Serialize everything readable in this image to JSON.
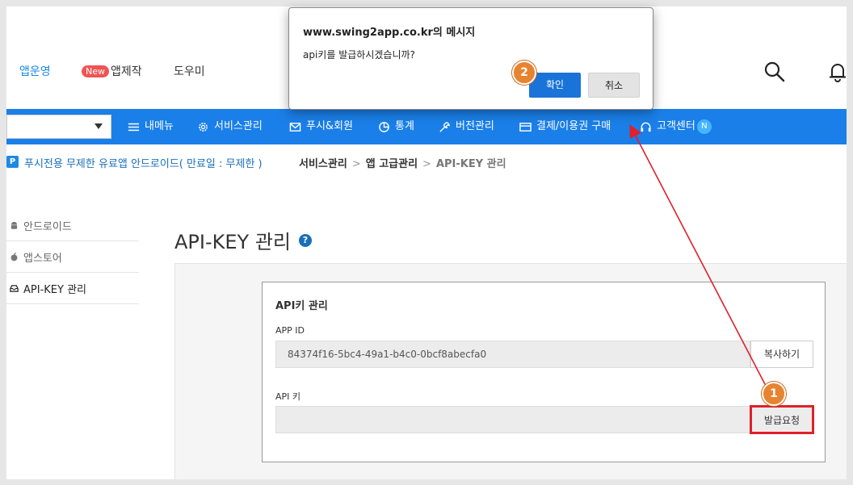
{
  "colors": {
    "accent": "#1a7fe8",
    "annotation_red": "#e0202a",
    "step_orange": "#e8832f",
    "new_badge": "#ef5454"
  },
  "topnav": {
    "items": [
      {
        "label": "앱운영"
      },
      {
        "badge": "New",
        "label": "앱제작"
      },
      {
        "label": "도우미"
      }
    ],
    "icons": [
      "search-icon",
      "bell-icon"
    ]
  },
  "menubar": {
    "items": [
      {
        "label": "내메뉴",
        "icon": "hamburger-icon"
      },
      {
        "label": "서비스관리",
        "icon": "gear-icon"
      },
      {
        "label": "푸시&회원",
        "icon": "mail-icon"
      },
      {
        "label": "통계",
        "icon": "pie-chart-icon"
      },
      {
        "label": "버전관리",
        "icon": "wrench-icon"
      },
      {
        "label": "결제/이용권 구매",
        "icon": "card-icon"
      },
      {
        "label": "고객센터",
        "icon": "headset-icon",
        "badge": "N"
      }
    ]
  },
  "crumbrow": {
    "app_badge": "P",
    "app_name": "푸시전용 무제한 유료앱 안드로이드( 만료일 : 무제한 )",
    "crumbs": [
      "서비스관리",
      "앱 고급관리",
      "API-KEY 관리"
    ],
    "separator": ">"
  },
  "sidebar": {
    "items": [
      {
        "label": "안드로이드",
        "icon": "android-icon"
      },
      {
        "label": "앱스토어",
        "icon": "apple-icon"
      },
      {
        "label": "API-KEY 관리",
        "icon": "inbox-icon"
      }
    ]
  },
  "page": {
    "title": "API-KEY 관리",
    "help": "?"
  },
  "panel": {
    "title": "API키 관리",
    "app_id_label": "APP ID",
    "app_id_value": "84374f16-5bc4-49a1-b4c0-0bcf8abecfa0",
    "copy_button": "복사하기",
    "api_key_label": "API 키",
    "api_key_value": "",
    "issue_button": "발급요청"
  },
  "steps": {
    "one": "1",
    "two": "2"
  },
  "dialog": {
    "title": "www.swing2app.co.kr의 메시지",
    "message": "api키를 발급하시겠습니까?",
    "ok": "확인",
    "cancel": "취소"
  }
}
